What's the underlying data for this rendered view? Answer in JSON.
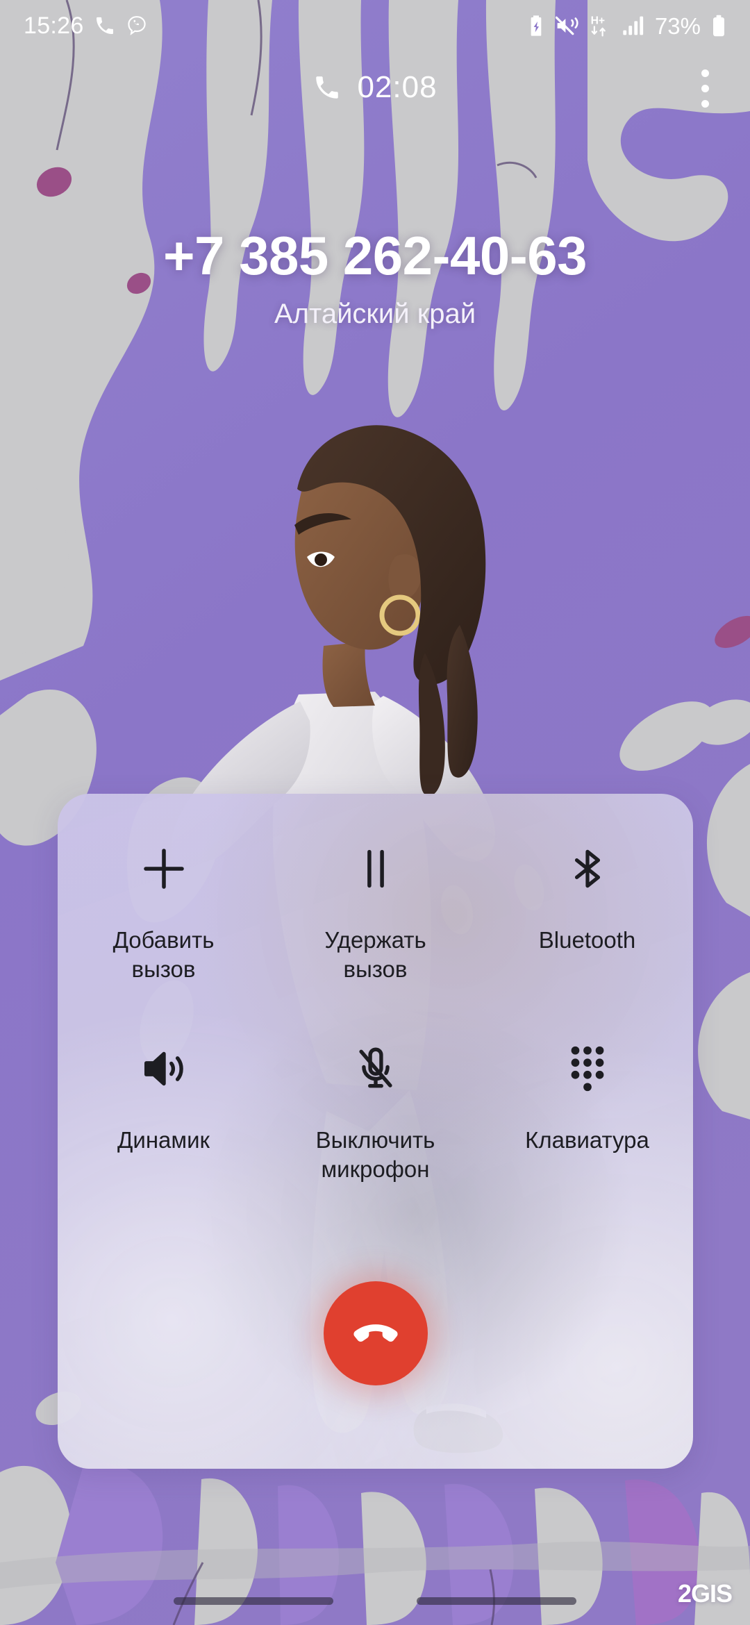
{
  "status_bar": {
    "time": "15:26",
    "battery_percent": "73%",
    "left_icons": [
      "phone-call-icon",
      "viber-icon"
    ],
    "right_icons": [
      "battery-charging-icon",
      "sound-mute-vibrate-icon",
      "hplus-data-icon",
      "signal-bars-icon",
      "battery-icon"
    ]
  },
  "call_header": {
    "timer": "02:08",
    "phone_icon": "phone-handset-icon",
    "overflow_icon": "more-vertical-icon"
  },
  "caller": {
    "number": "+7 385 262-40-63",
    "region": "Алтайский край"
  },
  "controls": {
    "row1": [
      {
        "label": "Добавить\nвызов",
        "line1": "Добавить",
        "line2": "вызов",
        "icon": "plus-icon",
        "name": "add-call-button"
      },
      {
        "label": "Удержать\nвызов",
        "line1": "Удержать",
        "line2": "вызов",
        "icon": "pause-icon",
        "name": "hold-call-button"
      },
      {
        "label": "Bluetooth",
        "line1": "Bluetooth",
        "line2": "",
        "icon": "bluetooth-icon",
        "name": "bluetooth-button"
      }
    ],
    "row2": [
      {
        "label": "Динамик",
        "line1": "Динамик",
        "line2": "",
        "icon": "speaker-icon",
        "name": "speaker-button"
      },
      {
        "label": "Выключить\nмикрофон",
        "line1": "Выключить",
        "line2": "микрофон",
        "icon": "mic-off-icon",
        "name": "mute-microphone-button"
      },
      {
        "label": "Клавиатура",
        "line1": "Клавиатура",
        "line2": "",
        "icon": "dialpad-icon",
        "name": "dialpad-button"
      }
    ],
    "end_call": {
      "icon": "end-call-handset-icon",
      "color": "#e0402f"
    }
  },
  "bottom": {
    "watermark": "2GIS",
    "nav_handles": 2
  },
  "colors": {
    "wallpaper_purple": "#8b76c8",
    "wallpaper_grey": "#c9c9cb",
    "panel_lavender": "#cbc4e8",
    "end_call_red": "#e0402f",
    "text_light": "#ffffff",
    "text_dark": "#1d1d22"
  }
}
